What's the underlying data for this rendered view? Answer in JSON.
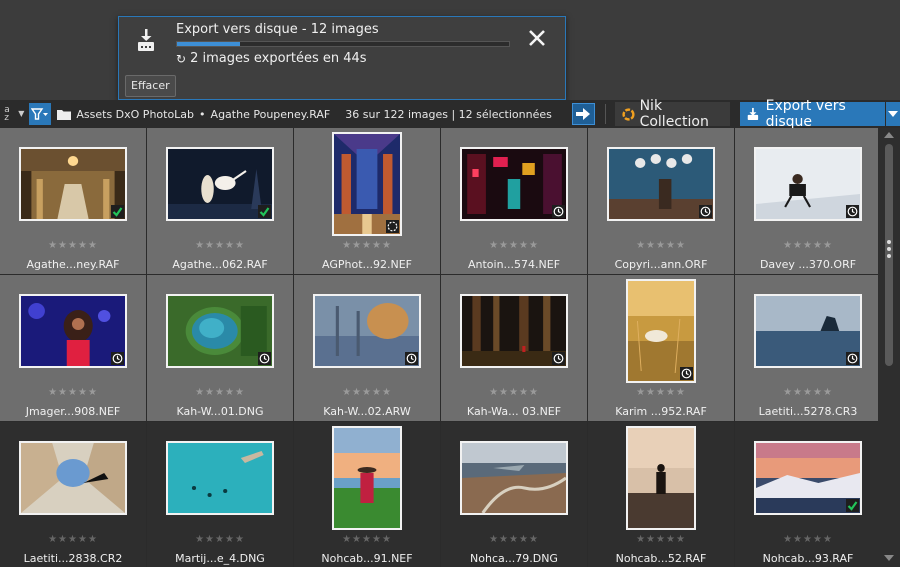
{
  "export_popup": {
    "title": "Export vers disque - 12 images",
    "progress": 0.19,
    "status": "2 images exportées en 44s",
    "clear_label": "Effacer"
  },
  "toolbar": {
    "sort_label": "a z",
    "path_folder": "Assets DxO PhotoLab",
    "path_separator": "•",
    "path_file": "Agathe Poupeney.RAF",
    "count": "36 sur 122 images | 12 sélectionnées",
    "nik_label": "Nik Collection",
    "export_label": "Export vers disque",
    "icons": [
      "sort-icon",
      "filter-icon",
      "folder-icon",
      "arrow-right-icon",
      "nik-icon",
      "export-icon",
      "chevron-down-icon"
    ]
  },
  "colors": {
    "accent": "#2a78b9",
    "check": "#22c45a",
    "cell_selected": "#6e6e6e",
    "cell_unselected": "#2e2e2e"
  },
  "rating_stars": "★★★★★",
  "thumbnails": [
    {
      "name": "Agathe...ney.RAF",
      "status": "exported",
      "selected": true,
      "scene": "opera",
      "orient": "land"
    },
    {
      "name": "Agathe...062.RAF",
      "status": "exported",
      "selected": true,
      "scene": "ballet",
      "orient": "land"
    },
    {
      "name": "AGPhot...92.NEF",
      "status": "processing",
      "selected": true,
      "scene": "chapel",
      "orient": "port"
    },
    {
      "name": "Antoin...574.NEF",
      "status": "pending",
      "selected": true,
      "scene": "neon",
      "orient": "land"
    },
    {
      "name": "Copyri...ann.ORF",
      "status": "pending",
      "selected": true,
      "scene": "room",
      "orient": "land"
    },
    {
      "name": "Davey ...370.ORF",
      "status": "pending",
      "selected": true,
      "scene": "white",
      "orient": "land"
    },
    {
      "name": "Jmager...908.NEF",
      "status": "pending",
      "selected": true,
      "scene": "singer",
      "orient": "land"
    },
    {
      "name": "Kah-W...01.DNG",
      "status": "pending",
      "selected": true,
      "scene": "lake",
      "orient": "land"
    },
    {
      "name": "Kah-W...02.ARW",
      "status": "pending",
      "selected": true,
      "scene": "mist",
      "orient": "land"
    },
    {
      "name": "Kah-Wa... 03.NEF",
      "status": "pending",
      "selected": true,
      "scene": "forest",
      "orient": "land"
    },
    {
      "name": "Karim ...952.RAF",
      "status": "pending",
      "selected": true,
      "scene": "golden",
      "orient": "port"
    },
    {
      "name": "Laetiti...5278.CR3",
      "status": "pending",
      "selected": true,
      "scene": "sea",
      "orient": "land"
    },
    {
      "name": "Laetiti...2838.CR2",
      "status": "none",
      "selected": false,
      "scene": "arch",
      "orient": "land"
    },
    {
      "name": "Martij...e_4.DNG",
      "status": "none",
      "selected": false,
      "scene": "teal",
      "orient": "land"
    },
    {
      "name": "Nohcab...91.NEF",
      "status": "none",
      "selected": false,
      "scene": "field",
      "orient": "port"
    },
    {
      "name": "Nohca...79.DNG",
      "status": "none",
      "selected": false,
      "scene": "aerial",
      "orient": "land"
    },
    {
      "name": "Nohcab...52.RAF",
      "status": "none",
      "selected": false,
      "scene": "hiker",
      "orient": "port"
    },
    {
      "name": "Nohcab...93.RAF",
      "status": "exported",
      "selected": false,
      "scene": "sunset",
      "orient": "land"
    }
  ]
}
